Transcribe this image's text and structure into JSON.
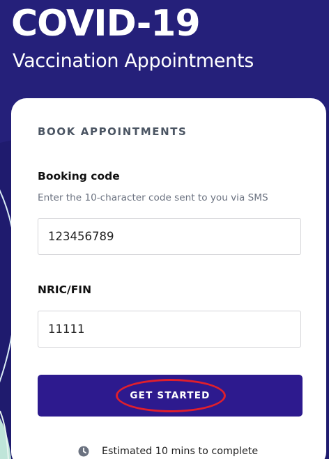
{
  "hero": {
    "title": "COVID-19",
    "subtitle": "Vaccination Appointments"
  },
  "card": {
    "section_heading": "BOOK APPOINTMENTS",
    "booking_code": {
      "label": "Booking code",
      "helper": "Enter the 10-character code sent to you via SMS",
      "value": "123456789"
    },
    "nric": {
      "label": "NRIC/FIN",
      "value": "11111"
    },
    "button_label": "GET STARTED",
    "estimate_text": "Estimated 10 mins to complete"
  },
  "colors": {
    "hero_background": "#1f1b6e",
    "button": "#2d1a8e",
    "highlight": "#e01f2c"
  },
  "icons": {
    "estimate": "clock-icon"
  }
}
